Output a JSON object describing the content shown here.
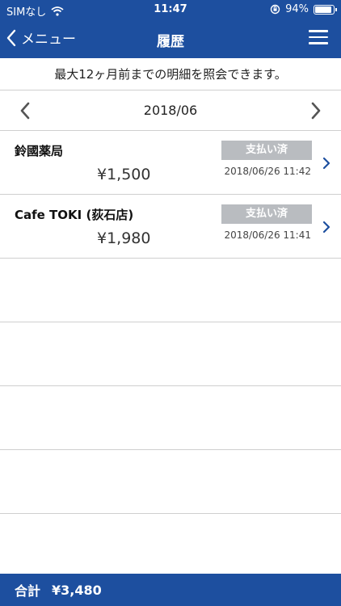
{
  "status_bar": {
    "carrier": "SIMなし",
    "time": "11:47",
    "battery_percent": "94%",
    "battery_level": 0.94
  },
  "nav": {
    "back_label": "メニュー",
    "title": "履歴"
  },
  "notice": "最大12ヶ月前までの明細を照会できます。",
  "month": "2018/06",
  "transactions": [
    {
      "merchant": "鈴國薬局",
      "amount": "¥1,500",
      "status": "支払い済",
      "datetime": "2018/06/26 11:42"
    },
    {
      "merchant": "Cafe TOKI (荻石店)",
      "amount": "¥1,980",
      "status": "支払い済",
      "datetime": "2018/06/26 11:41"
    }
  ],
  "footer": {
    "total_label": "合計",
    "total_value": "¥3,480"
  },
  "colors": {
    "header_bg": "#1d4f9f",
    "badge_bg": "#b9bcc0",
    "chevron": "#1d4f9f"
  }
}
